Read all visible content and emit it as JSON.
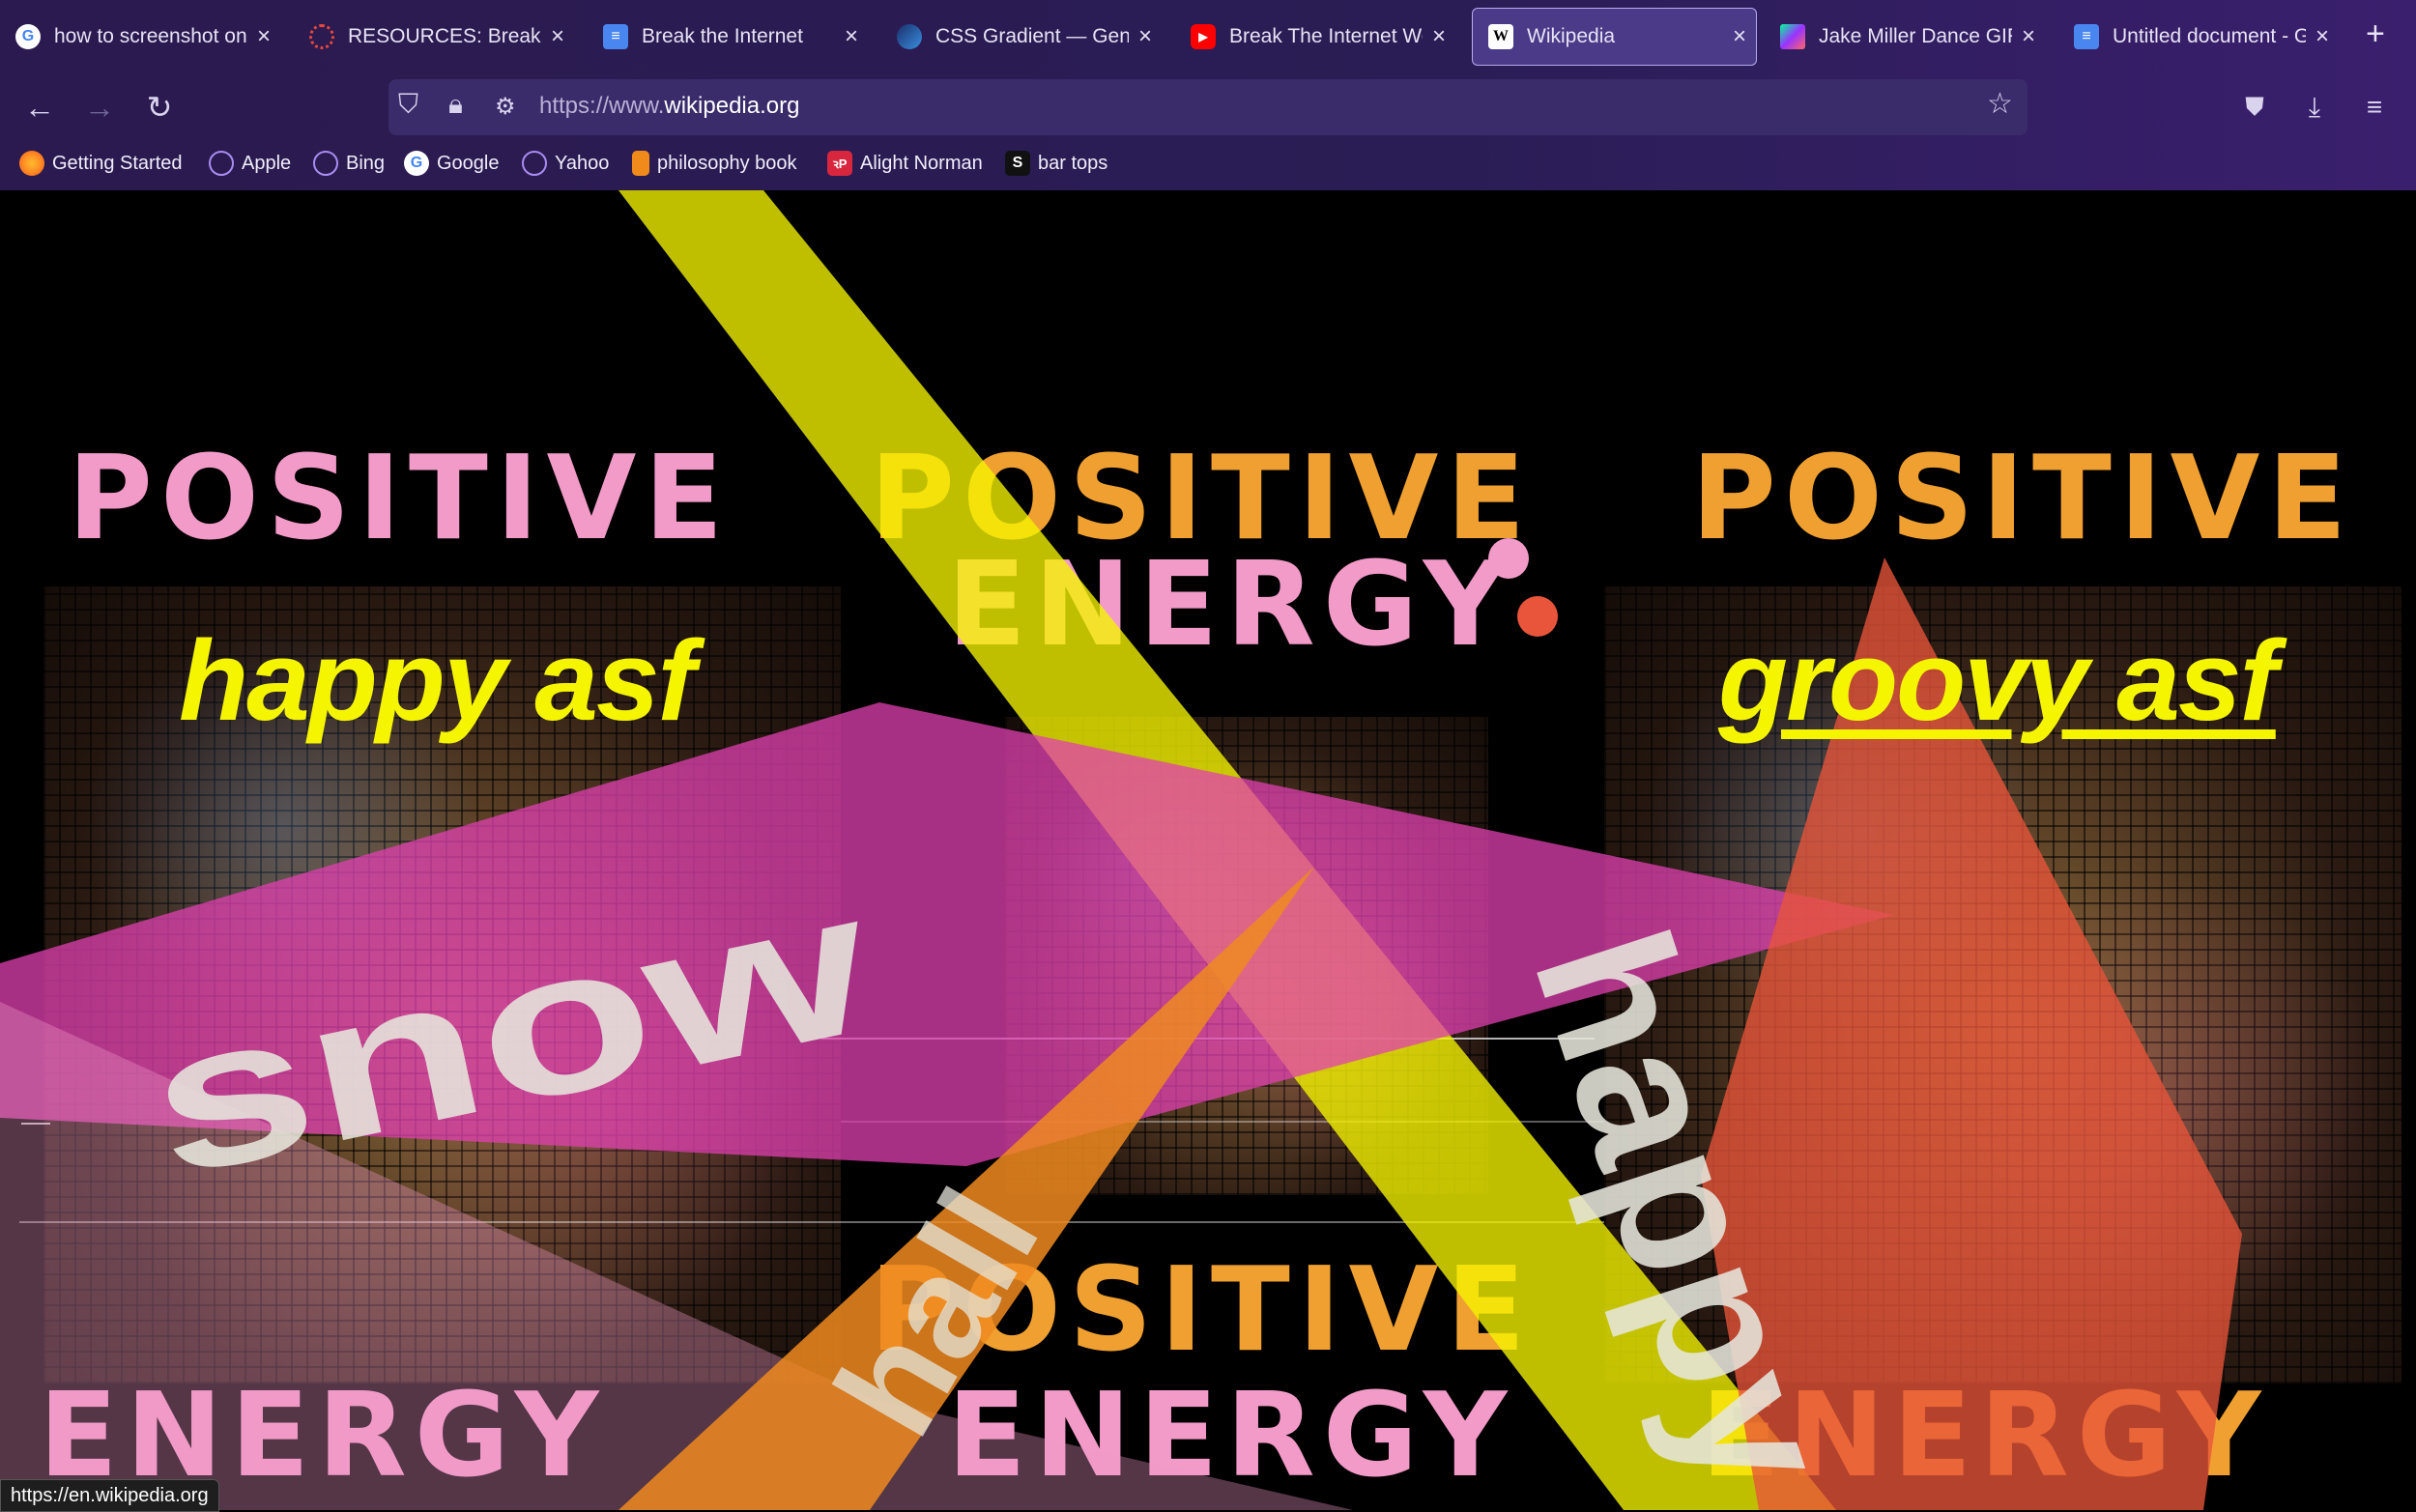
{
  "tabs": [
    {
      "title": "how to screenshot on m",
      "icon": "google-icon",
      "color": "#ffffff",
      "active": false
    },
    {
      "title": "RESOURCES: Break the",
      "icon": "resources-icon",
      "color": "#e8473d",
      "active": false
    },
    {
      "title": "Break the Internet",
      "icon": "docs-icon",
      "color": "#4a86f0",
      "active": false
    },
    {
      "title": "CSS Gradient — Gener",
      "icon": "gradient-icon",
      "color": "#2e6bd6",
      "active": false
    },
    {
      "title": "Break The Internet Wor",
      "icon": "youtube-icon",
      "color": "#ff0000",
      "active": false
    },
    {
      "title": "Wikipedia",
      "icon": "wikipedia-icon",
      "color": "#ffffff",
      "active": true
    },
    {
      "title": "Jake Miller Dance GIF",
      "icon": "giphy-icon",
      "color": "#00ff99",
      "active": false
    },
    {
      "title": "Untitled document - G",
      "icon": "docs-icon",
      "color": "#4a86f0",
      "active": false
    }
  ],
  "new_tab_label": "+",
  "url": {
    "prefix": "https://www.",
    "domain": "wikipedia.org"
  },
  "bookmarks": [
    {
      "label": "Getting Started",
      "icon": "firefox-icon",
      "color": "#ff7a1a"
    },
    {
      "label": "Apple",
      "icon": "globe-icon",
      "color": "#a98cf0"
    },
    {
      "label": "Bing",
      "icon": "globe-icon",
      "color": "#a98cf0"
    },
    {
      "label": "Google",
      "icon": "google-icon",
      "color": "#ffffff"
    },
    {
      "label": "Yahoo",
      "icon": "globe-icon",
      "color": "#a98cf0"
    },
    {
      "label": "philosophy book",
      "icon": "book-icon",
      "color": "#f08a1a"
    },
    {
      "label": "Alight Norman",
      "icon": "alight-icon",
      "color": "#d7263d"
    },
    {
      "label": "bar tops",
      "icon": "s-icon",
      "color": "#111111"
    }
  ],
  "page": {
    "poster_line1": "POSITIVE",
    "poster_line2": "ENERGY",
    "left_word": "happy asf",
    "right_word": "groovy asf",
    "slant_word_pink": "snow",
    "slant_word_right": "happy",
    "slant_word_bottom": "hall"
  },
  "status_url": "https://en.wikipedia.org",
  "colors": {
    "yellow": "#f5f500",
    "pink_beam": "#e040b0",
    "orange_beam": "#f08a20",
    "poster_pink": "#f29ac8",
    "poster_orange": "#f0a030",
    "poster_red": "#e8553a"
  }
}
